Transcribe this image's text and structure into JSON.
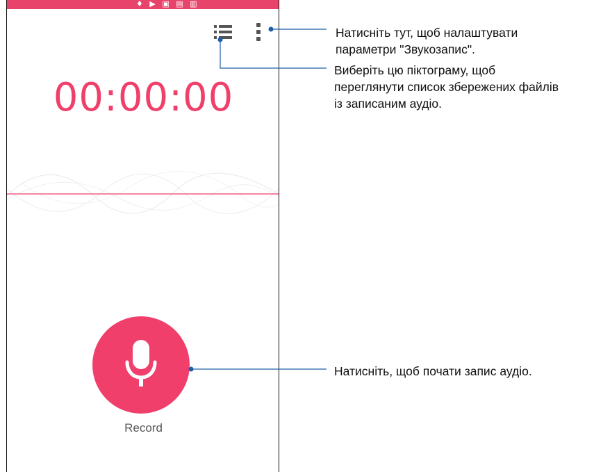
{
  "status_bar": {
    "icons": "♦ ▶ ▣ ▤ ▥",
    "color": "#e8446b"
  },
  "toolbar": {
    "file_list_icon": "list-icon",
    "settings_icon": "more-vertical-icon"
  },
  "timer": {
    "value": "00:00:00",
    "color": "#f03f6b"
  },
  "record": {
    "label": "Record",
    "icon": "microphone-icon",
    "color": "#f03f6b"
  },
  "callouts": {
    "settings": [
      "Натисніть тут, щоб налаштувати",
      "параметри \"Звукозапис\"."
    ],
    "file_list": [
      "Виберіть цю піктограму, щоб",
      "переглянути список збережених файлів",
      "із записаним аудіо."
    ],
    "record": [
      "Натисніть, щоб почати запис аудіо."
    ]
  },
  "line_color": "#1f5ea8"
}
